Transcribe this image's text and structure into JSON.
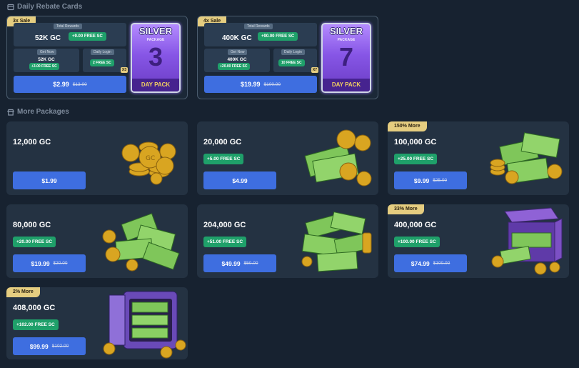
{
  "sections": {
    "rebate_title": "Daily Rebate Cards",
    "packages_title": "More Packages"
  },
  "rebate_cards": [
    {
      "badge": "3x Sale",
      "total_rewards_label": "Total Rewards",
      "total_gc": "52K GC",
      "total_sc": "+9.00 FREE SC",
      "get_now_label": "Get Now",
      "get_now_gc": "52K GC",
      "get_now_sc": "+3.00 FREE SC",
      "daily_login_label": "Daily Login",
      "daily_login_sc": "2 FREE SC",
      "multiplier": "X3",
      "price": "$2.99",
      "old_price": "$13.00",
      "card_title": "SILVER",
      "card_subtitle": "PACKAGE",
      "card_number": "3",
      "card_footer": "DAY PACK"
    },
    {
      "badge": "4x Sale",
      "total_rewards_label": "Total Rewards",
      "total_gc": "400K GC",
      "total_sc": "+90.00 FREE SC",
      "get_now_label": "Get Now",
      "get_now_gc": "400K GC",
      "get_now_sc": "+20.00 FREE SC",
      "daily_login_label": "Daily Login",
      "daily_login_sc": "10 FREE SC",
      "multiplier": "X7",
      "price": "$19.99",
      "old_price": "$100.00",
      "card_title": "SILVER",
      "card_subtitle": "PACKAGE",
      "card_number": "7",
      "card_footer": "DAY PACK"
    }
  ],
  "packages": [
    {
      "badge": "",
      "title": "12,000 GC",
      "sc": "",
      "price": "$1.99",
      "old_price": "",
      "art": "coins-icon"
    },
    {
      "badge": "",
      "title": "20,000 GC",
      "sc": "+5.00 FREE SC",
      "price": "$4.99",
      "old_price": "",
      "art": "cash-coins-icon"
    },
    {
      "badge": "150% More",
      "title": "100,000 GC",
      "sc": "+25.00 FREE SC",
      "price": "$9.99",
      "old_price": "$25.00",
      "art": "cash-stack-icon"
    },
    {
      "badge": "",
      "title": "80,000 GC",
      "sc": "+20.00 FREE SC",
      "price": "$19.99",
      "old_price": "$20.00",
      "art": "cash-pile-icon"
    },
    {
      "badge": "",
      "title": "204,000 GC",
      "sc": "+51.00 FREE SC",
      "price": "$49.99",
      "old_price": "$50.00",
      "art": "cash-heap-icon"
    },
    {
      "badge": "33% More",
      "title": "400,000 GC",
      "sc": "+100.00 FREE SC",
      "price": "$74.99",
      "old_price": "$100.00",
      "art": "treasure-box-icon"
    },
    {
      "badge": "2% More",
      "title": "408,000 GC",
      "sc": "+102.00 FREE SC",
      "price": "$99.99",
      "old_price": "$102.00",
      "art": "vault-icon"
    }
  ],
  "colors": {
    "background": "#172230",
    "card": "#243242",
    "accent_blue": "#3e6ee0",
    "green_pill": "#1fa06a",
    "badge_gold": "#e5cd80",
    "silver_purple": "#8756e6"
  }
}
